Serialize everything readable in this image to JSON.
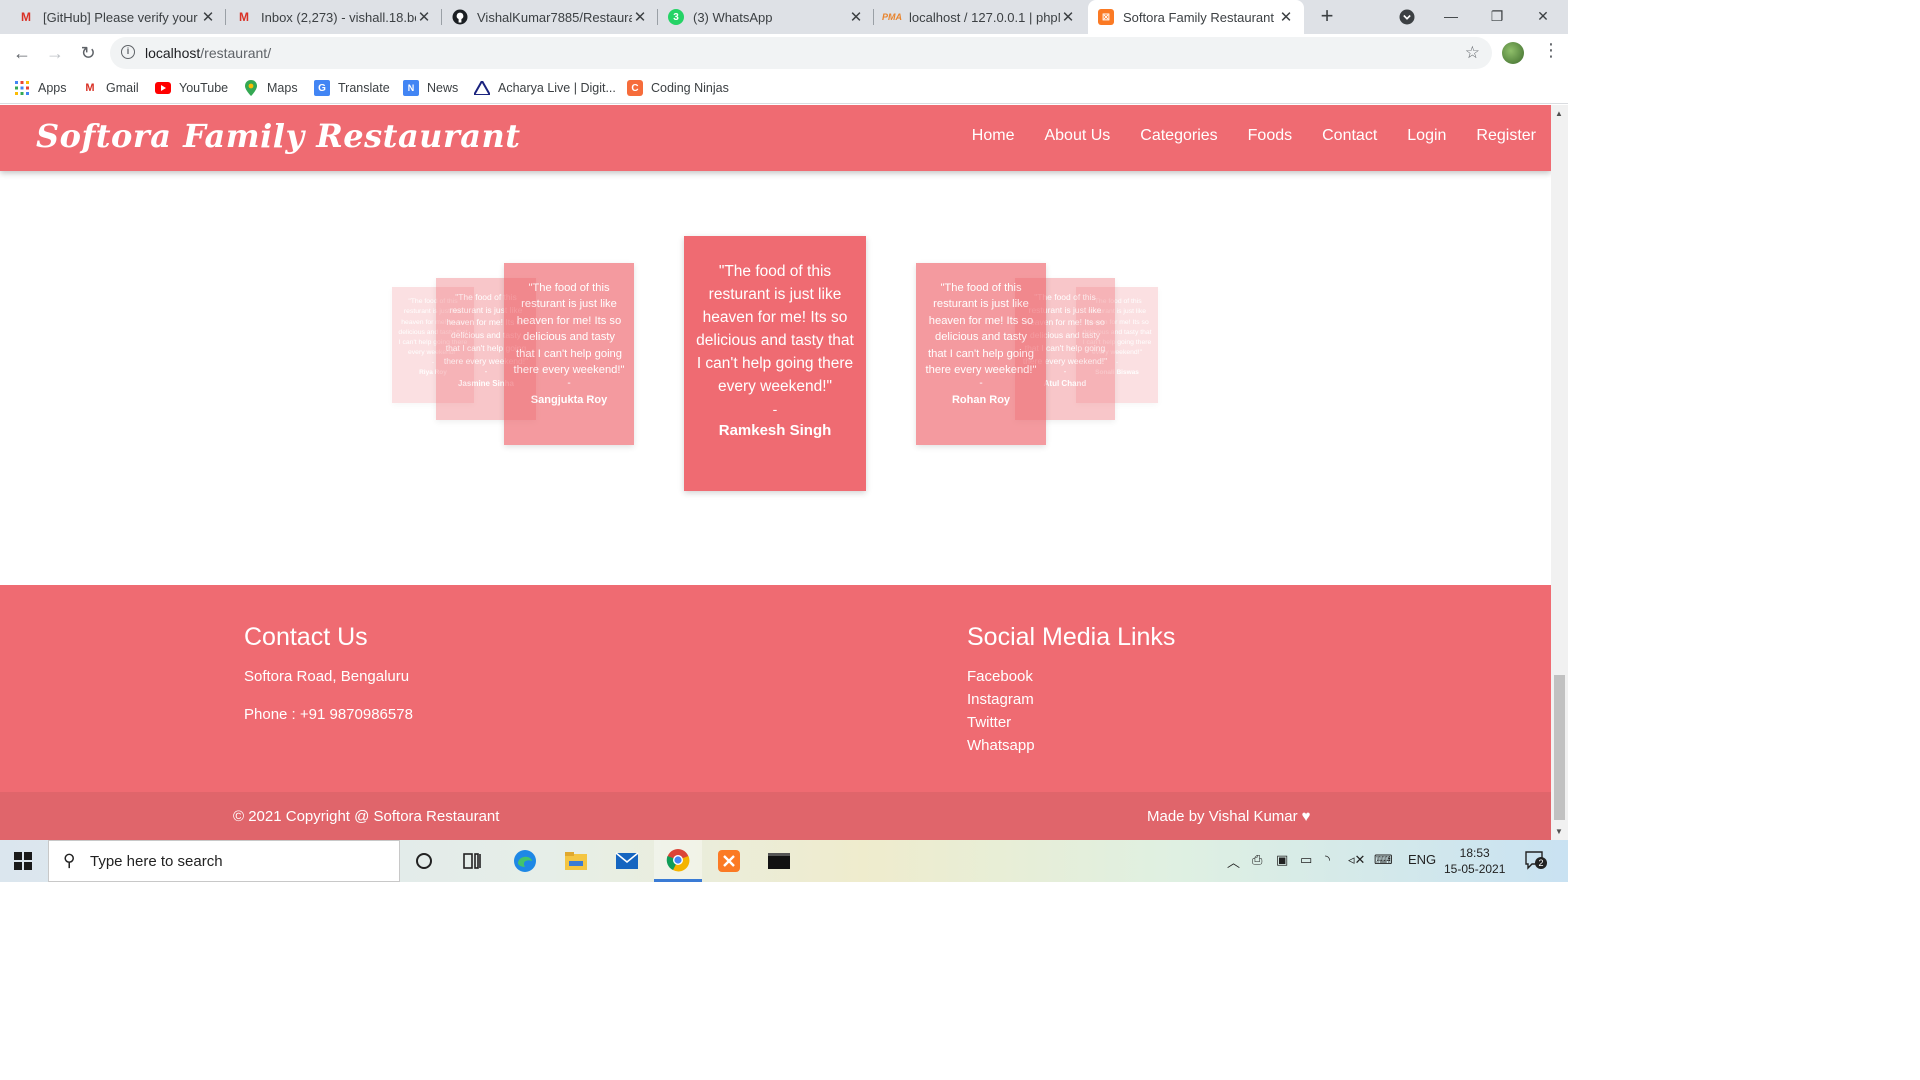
{
  "browser": {
    "tabs": [
      {
        "title": "[GitHub] Please verify your d",
        "icon": "gmail-icon"
      },
      {
        "title": "Inbox (2,273) - vishall.18.be",
        "icon": "gmail-icon"
      },
      {
        "title": "VishalKumar7885/Restauran",
        "icon": "github-icon"
      },
      {
        "title": "(3) WhatsApp",
        "icon": "whatsapp-icon",
        "badge": "3"
      },
      {
        "title": "localhost / 127.0.0.1 | phpM",
        "icon": "phpmyadmin-icon"
      },
      {
        "title": "Softora Family Restaurant",
        "icon": "xampp-icon"
      }
    ],
    "url_host": "localhost",
    "url_path": "/restaurant/",
    "bookmarks": [
      {
        "label": "Apps"
      },
      {
        "label": "Gmail"
      },
      {
        "label": "YouTube"
      },
      {
        "label": "Maps"
      },
      {
        "label": "Translate"
      },
      {
        "label": "News"
      },
      {
        "label": "Acharya Live | Digit..."
      },
      {
        "label": "Coding Ninjas"
      }
    ]
  },
  "site": {
    "brand": "Softora Family Restaurant",
    "nav": [
      "Home",
      "About Us",
      "Categories",
      "Foods",
      "Contact",
      "Login",
      "Register"
    ],
    "testimonials": {
      "quote": "\"The food of this resturant is just like heaven for me! Its so delicious and tasty that I can't help going there every weekend!\"",
      "dash": "-",
      "center": "Ramkesh Singh",
      "left_1": "Sangjukta Roy",
      "left_2": "Jasmine Sinha",
      "left_3": "Riya Roy",
      "right_1": "Rohan Roy",
      "right_2": "Atul Chand",
      "right_3": "Sonali Biswas"
    },
    "footer": {
      "contact_title": "Contact Us",
      "address": "Softora Road, Bengaluru",
      "phone": "Phone : +91 9870986578",
      "social_title": "Social Media Links",
      "social": [
        "Facebook",
        "Instagram",
        "Twitter",
        "Whatsapp"
      ],
      "copyright": "© 2021 Copyright @ Softora Restaurant",
      "made_by": "Made by Vishal Kumar"
    }
  },
  "taskbar": {
    "search_placeholder": "Type here to search",
    "lang": "ENG",
    "time": "18:53",
    "date": "15-05-2021",
    "notifications": "2"
  },
  "colors": {
    "brand": "#ef6b72",
    "copybar": "#e0656b"
  }
}
